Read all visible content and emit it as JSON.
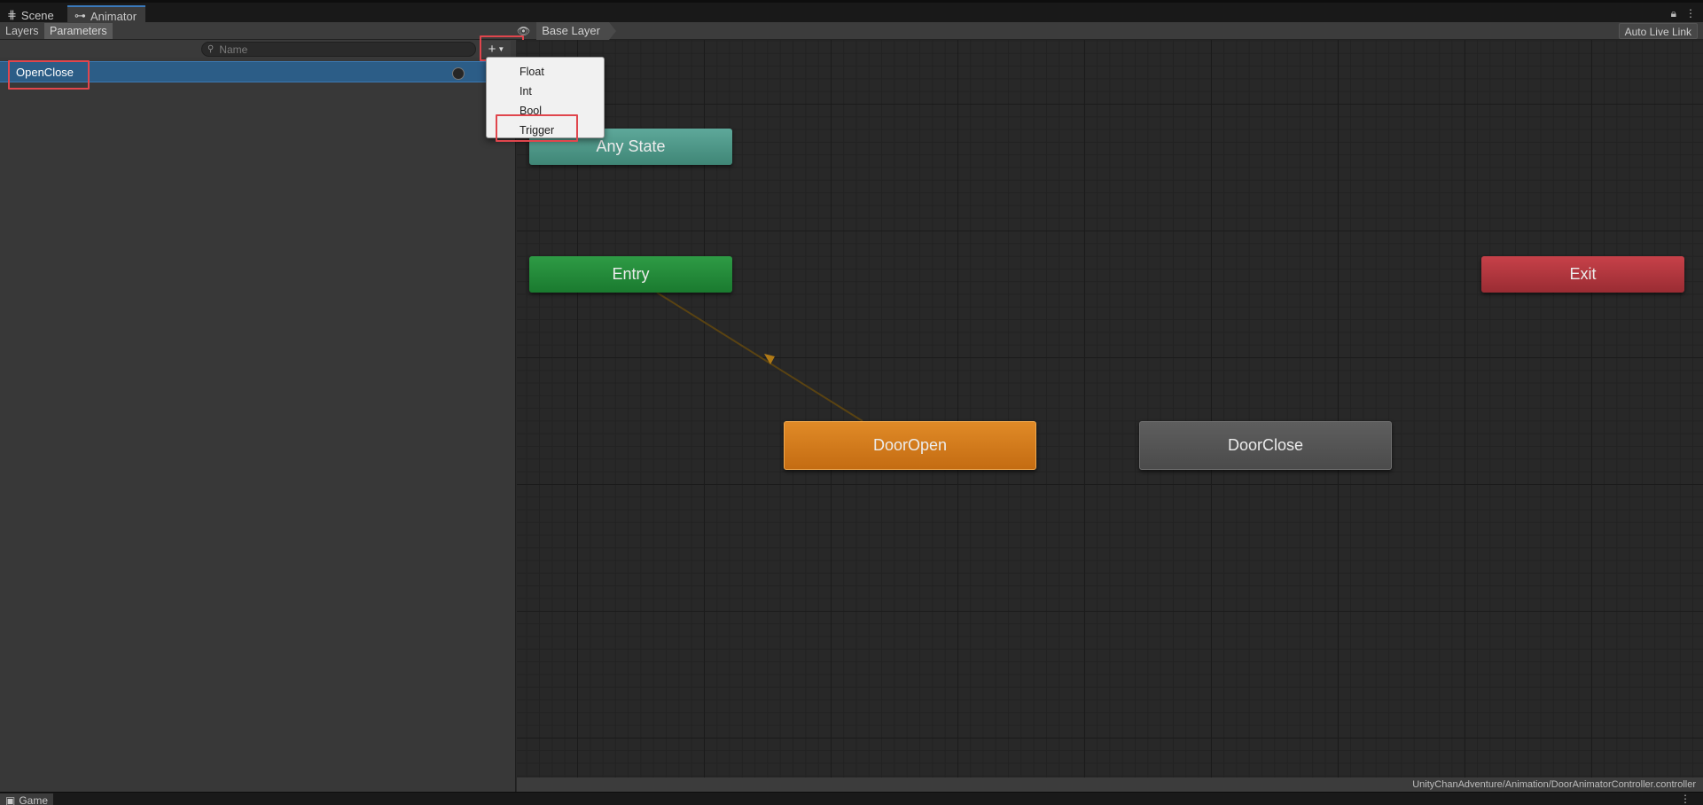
{
  "tabs": {
    "scene": {
      "label": "Scene",
      "icon": "grid-icon"
    },
    "animator": {
      "label": "Animator",
      "icon": "animator-icon"
    }
  },
  "toolbar": {
    "layers_label": "Layers",
    "parameters_label": "Parameters",
    "breadcrumb": "Base Layer",
    "auto_live_link": "Auto Live Link"
  },
  "search": {
    "placeholder": "Name",
    "value": ""
  },
  "add_button": {
    "symbol": "+",
    "icon": "plus-icon"
  },
  "parameters": [
    {
      "name": "OpenClose",
      "type": "Trigger"
    }
  ],
  "dropdown": {
    "items": [
      "Float",
      "Int",
      "Bool",
      "Trigger"
    ],
    "highlighted": "Trigger"
  },
  "graph": {
    "nodes": {
      "any_state": "Any State",
      "entry": "Entry",
      "exit": "Exit",
      "door_open": "DoorOpen",
      "door_close": "DoorClose"
    }
  },
  "status": {
    "path": "UnityChanAdventure/Animation/DoorAnimatorController.controller"
  },
  "bottom": {
    "game_tab": "Game"
  },
  "colors": {
    "selection": "#2c5d87",
    "highlight_box": "#e0464d",
    "any_state": "#4f9a8a",
    "entry": "#258c3b",
    "exit": "#b3363e",
    "default_state": "#d47b1c",
    "state": "#555555"
  }
}
